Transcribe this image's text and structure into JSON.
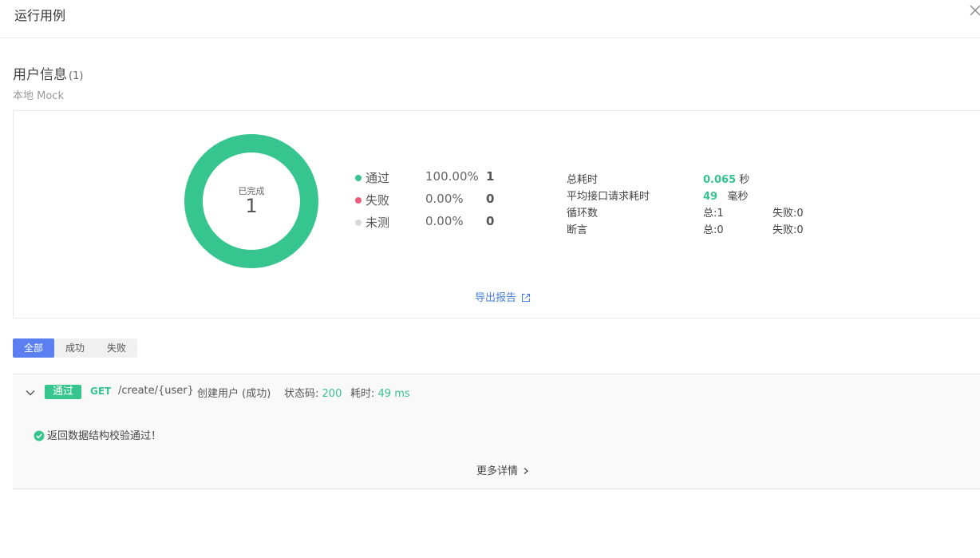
{
  "window": {
    "title": "运行用例"
  },
  "case": {
    "name": "用户信息",
    "count": "(1)",
    "environment": "本地 Mock"
  },
  "summary": {
    "donut_label": "已完成",
    "donut_value": "1",
    "pass_ratio": 1.0,
    "legend": [
      {
        "name": "通过",
        "percent": "100.00%",
        "count": "1",
        "color": "#36c48f"
      },
      {
        "name": "失败",
        "percent": "0.00%",
        "count": "0",
        "color": "#ef5b7a"
      },
      {
        "name": "未测",
        "percent": "0.00%",
        "count": "0",
        "color": "#d9d9d9"
      }
    ],
    "stats": {
      "total_time_label": "总耗时",
      "total_time_value": "0.065",
      "total_time_unit": "秒",
      "avg_time_label": "平均接口请求耗时",
      "avg_time_value": "49",
      "avg_time_unit": "毫秒",
      "loops_label": "循环数",
      "loops_total": "总:1",
      "loops_failed": "失败:0",
      "assert_label": "断言",
      "assert_total": "总:0",
      "assert_failed": "失败:0"
    },
    "export_label": "导出报告"
  },
  "filters": {
    "all": "全部",
    "success": "成功",
    "fail": "失败"
  },
  "result": {
    "tag": "通过",
    "method": "GET",
    "path": "/create/{user}",
    "name": "创建用户 (成功)",
    "status_label": "状态码:",
    "status_value": "200",
    "time_label": "耗时:",
    "time_value": "49 ms",
    "assertion": "返回数据结构校验通过！",
    "more_label": "更多详情"
  },
  "colors": {
    "pass": "#36c48f",
    "fail": "#ef5b7a",
    "untested": "#d9d9d9",
    "accent": "#5b7ff0",
    "link": "#4a7fd6"
  }
}
